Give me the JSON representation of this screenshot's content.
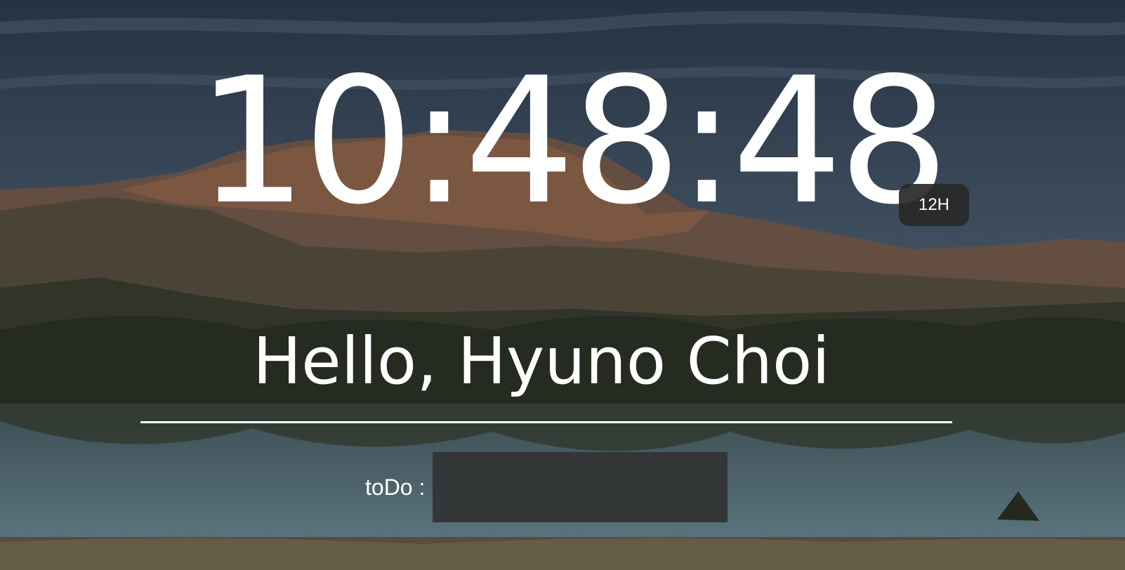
{
  "clock": {
    "time": "10:48:48",
    "mode_label": "12H"
  },
  "greeting": {
    "text": "Hello, Hyuno Choi"
  },
  "todo": {
    "label": "toDo :",
    "value": "",
    "placeholder": ""
  },
  "colors": {
    "text": "#ffffff",
    "button_bg": "#282828",
    "input_bg": "#303030",
    "sky": "#4a5a6e",
    "mountain": "#8a6a55",
    "water": "#5f7a86"
  }
}
